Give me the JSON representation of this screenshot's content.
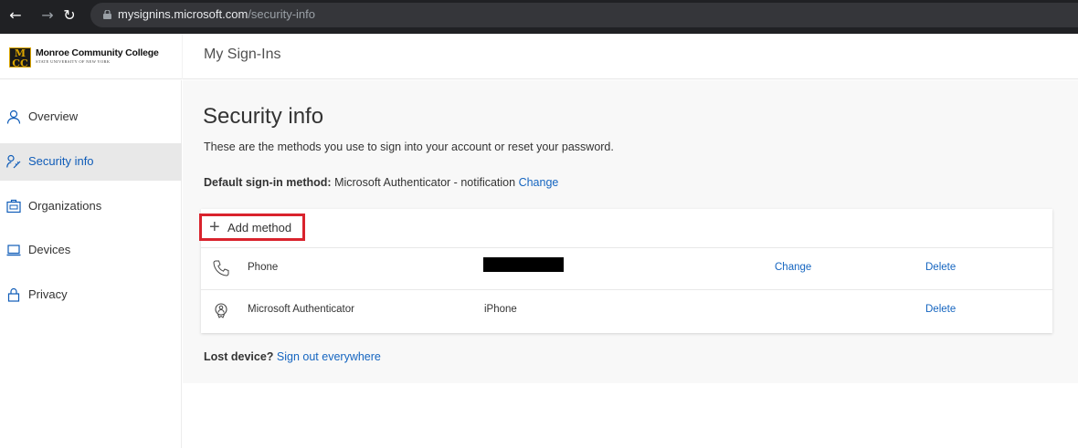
{
  "browser": {
    "url_host": "mysignins.microsoft.com",
    "url_path": "/security-info"
  },
  "header": {
    "logo_name": "Monroe Community College",
    "logo_sub": "STATE UNIVERSITY OF NEW YORK",
    "logo_mark": "MCC",
    "app_title": "My Sign-Ins"
  },
  "sidebar": {
    "items": [
      {
        "label": "Overview",
        "icon": "person-icon",
        "active": false
      },
      {
        "label": "Security info",
        "icon": "security-info-icon",
        "active": true
      },
      {
        "label": "Organizations",
        "icon": "organization-icon",
        "active": false
      },
      {
        "label": "Devices",
        "icon": "laptop-icon",
        "active": false
      },
      {
        "label": "Privacy",
        "icon": "lock-icon",
        "active": false
      }
    ]
  },
  "main": {
    "title": "Security info",
    "description": "These are the methods you use to sign into your account or reset your password.",
    "default_label": "Default sign-in method:",
    "default_value": "Microsoft Authenticator - notification",
    "default_change": "Change",
    "add_method_label": "Add method",
    "methods": [
      {
        "name": "Phone",
        "icon": "phone-icon",
        "detail": "",
        "detail_redacted": true,
        "change": "Change",
        "delete": "Delete"
      },
      {
        "name": "Microsoft Authenticator",
        "icon": "authenticator-icon",
        "detail": "iPhone",
        "detail_redacted": false,
        "change": "",
        "delete": "Delete"
      }
    ],
    "lost_label": "Lost device?",
    "lost_link": "Sign out everywhere"
  },
  "colors": {
    "accent": "#1565c0",
    "highlight_box": "#d9232d",
    "active_nav_bg": "#e8e8e8",
    "browser_bar": "#202124"
  }
}
